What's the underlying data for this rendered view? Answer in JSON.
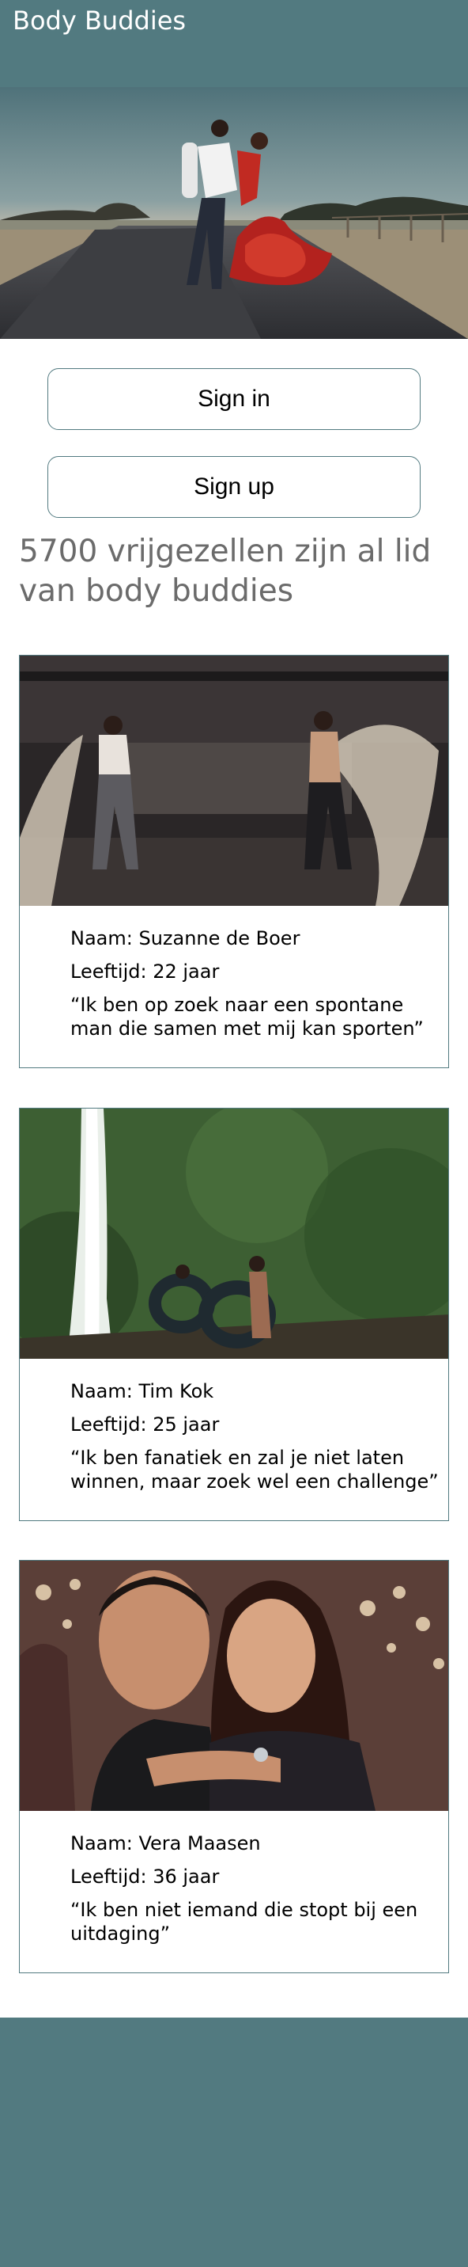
{
  "header": {
    "brand": "Body Buddies"
  },
  "auth": {
    "sign_in_label": "Sign in",
    "sign_up_label": "Sign up"
  },
  "members_heading": "5700 vrijgezellen zijn al lid van body buddies",
  "profiles": [
    {
      "name": "Naam: Suzanne de Boer",
      "age": "Leeftijd: 22 jaar",
      "quote": "“Ik ben op zoek naar een spontane man die samen met mij kan sporten”"
    },
    {
      "name": "Naam: Tim Kok",
      "age": "Leeftijd: 25 jaar",
      "quote": "“Ik ben fanatiek en zal je niet laten winnen, maar zoek wel een challenge”"
    },
    {
      "name": "Naam: Vera Maasen",
      "age": "Leeftijd: 36 jaar",
      "quote": "“Ik ben niet iemand die stopt bij een uitdaging”"
    }
  ],
  "colors": {
    "brand": "#527a80",
    "muted_text": "#6b6b6b"
  }
}
